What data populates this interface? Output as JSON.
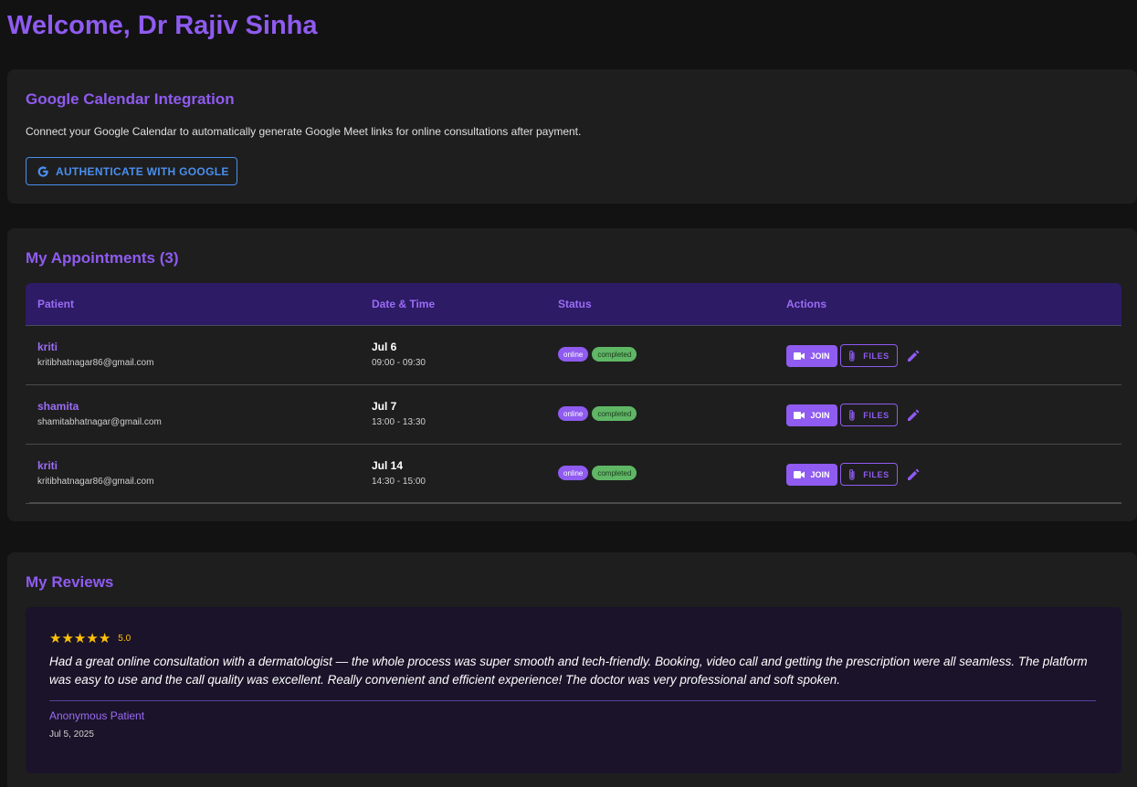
{
  "page": {
    "title": "Welcome, Dr Rajiv Sinha"
  },
  "google_calendar": {
    "title": "Google Calendar Integration",
    "description": "Connect your Google Calendar to automatically generate Google Meet links for online consultations after payment.",
    "button_label": "AUTHENTICATE WITH GOOGLE",
    "button_icon": "google-g-icon"
  },
  "appointments": {
    "title": "My Appointments (3)",
    "columns": [
      "Patient",
      "Date & Time",
      "Status",
      "Actions"
    ],
    "rows": [
      {
        "name": "kriti",
        "email": "kritibhatnagar86@gmail.com",
        "date": "Jul 6",
        "time": "09:00 - 09:30",
        "mode": "online",
        "status": "completed"
      },
      {
        "name": "shamita",
        "email": "shamitabhatnagar@gmail.com",
        "date": "Jul 7",
        "time": "13:00 - 13:30",
        "mode": "online",
        "status": "completed"
      },
      {
        "name": "kriti",
        "email": "kritibhatnagar86@gmail.com",
        "date": "Jul 14",
        "time": "14:30 - 15:00",
        "mode": "online",
        "status": "completed"
      }
    ],
    "actions": {
      "join_label": "JOIN",
      "files_label": "FILES"
    }
  },
  "reviews": {
    "title": "My Reviews",
    "items": [
      {
        "stars": 5,
        "rating": "5.0",
        "text": "Had a great online consultation with a dermatologist — the whole process was super smooth and tech-friendly. Booking, video call and getting the prescription were all seamless. The platform was easy to use and the call quality was excellent. Really convenient and efficient experience! The doctor was very professional and soft spoken.",
        "author": "Anonymous Patient",
        "date": "Jul 5, 2025"
      }
    ]
  },
  "colors": {
    "accent": "#8f5bf0",
    "google_blue": "#4a8ff0",
    "success": "#5fb665",
    "star": "#ffc107"
  }
}
